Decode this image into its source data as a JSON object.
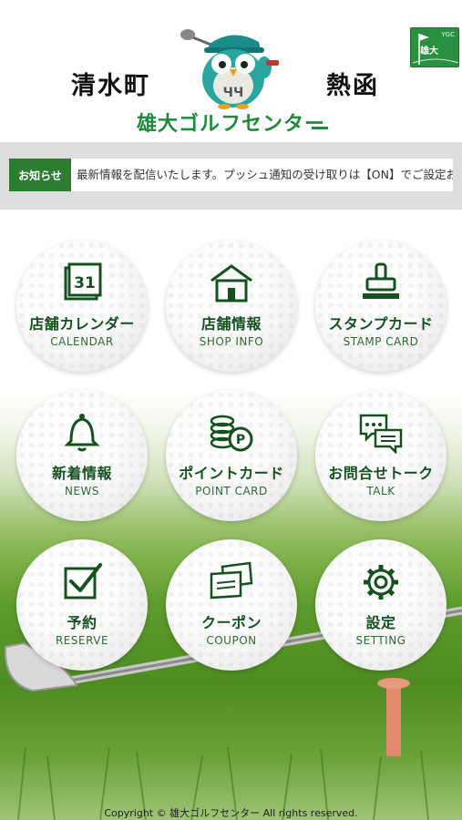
{
  "header": {
    "location_left": "清水町",
    "location_right": "熱函",
    "brand_name": "雄大ゴルフセンター",
    "badge": {
      "small_text": "YGC",
      "name": "雄大"
    }
  },
  "notice": {
    "label": "お知らせ",
    "text": "最新情報を配信いたします。プッシュ通知の受け取りは【ON】でご設定お願"
  },
  "menu": [
    {
      "jp": "店舗カレンダー",
      "en": "CALENDAR",
      "icon": "calendar-icon",
      "day": "31"
    },
    {
      "jp": "店舗情報",
      "en": "SHOP INFO",
      "icon": "shop-icon"
    },
    {
      "jp": "スタンプカード",
      "en": "STAMP CARD",
      "icon": "stamp-icon"
    },
    {
      "jp": "新着情報",
      "en": "NEWS",
      "icon": "bell-icon"
    },
    {
      "jp": "ポイントカード",
      "en": "POINT CARD",
      "icon": "point-coins-icon",
      "badge": "P"
    },
    {
      "jp": "お問合せトーク",
      "en": "TALK",
      "icon": "chat-bubbles-icon"
    },
    {
      "jp": "予約",
      "en": "RESERVE",
      "icon": "checkbox-icon"
    },
    {
      "jp": "クーポン",
      "en": "COUPON",
      "icon": "coupon-tickets-icon"
    },
    {
      "jp": "設定",
      "en": "SETTING",
      "icon": "gear-icon"
    }
  ],
  "footer": {
    "copyright": "Copyright © 雄大ゴルフセンター All rights reserved."
  },
  "colors": {
    "brand_green": "#1f8a3c",
    "label_green": "#14511f",
    "notice_green": "#2c7d32"
  }
}
